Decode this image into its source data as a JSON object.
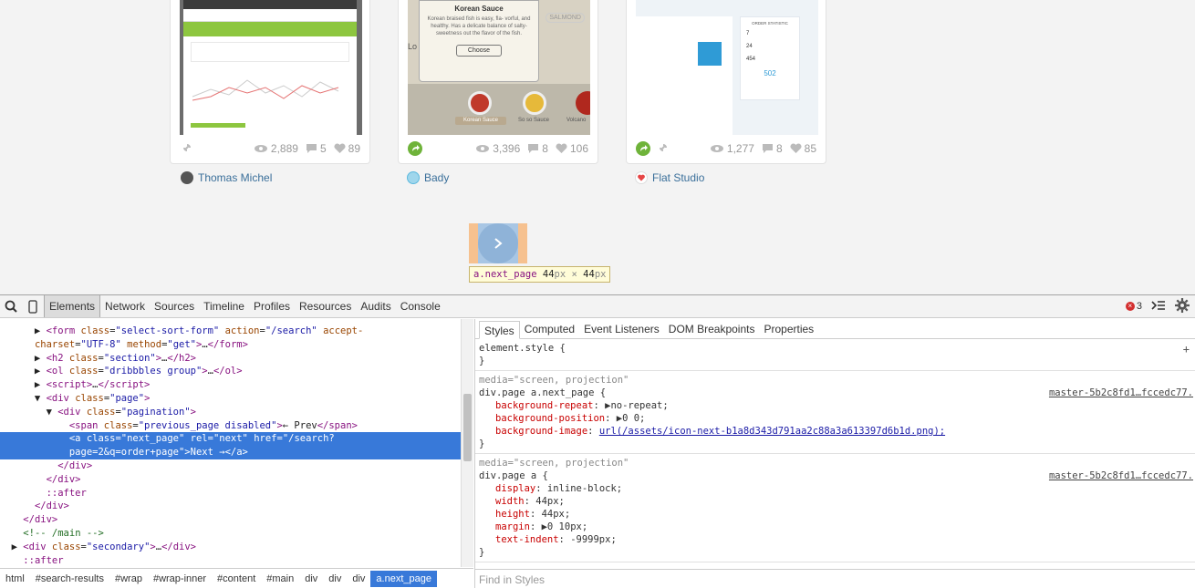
{
  "shots": [
    {
      "views": "2,889",
      "comments": "5",
      "likes": "89",
      "author": "Thomas Michel"
    },
    {
      "popup_title": "Korean Sauce",
      "popup_text": "Korean braised fish is easy, fla- vorful, and healthy. Has a delicate balance of salty-sweetness out the flavor of the fish.",
      "popup_button": "Choose",
      "corner_label": "SALMOND",
      "side_label": "Lo",
      "items": [
        "Korean Sauce",
        "So so Sauce",
        "Volcano"
      ],
      "views": "3,396",
      "comments": "8",
      "likes": "106",
      "author": "Bady"
    },
    {
      "stat_title": "ORDER STATISTIC",
      "stat_values": [
        "7",
        "24",
        "454"
      ],
      "big_value": "502",
      "views": "1,277",
      "comments": "8",
      "likes": "85",
      "author": "Flat Studio"
    }
  ],
  "tooltip": {
    "tag": "a.next_page",
    "w": "44",
    "unit": "px",
    "x": " × ",
    "h": "44"
  },
  "devtools": {
    "tabs": [
      "Elements",
      "Network",
      "Sources",
      "Timeline",
      "Profiles",
      "Resources",
      "Audits",
      "Console"
    ],
    "error_count": "3",
    "breadcrumbs": [
      "html",
      "#search-results",
      "#wrap",
      "#wrap-inner",
      "#content",
      "#main",
      "div",
      "div",
      "div",
      "a.next_page"
    ],
    "style_tabs": [
      "Styles",
      "Computed",
      "Event Listeners",
      "DOM Breakpoints",
      "Properties"
    ],
    "find_placeholder": "Find in Styles",
    "element_style": "element.style {",
    "rule1": {
      "media": "media=\"screen, projection\"",
      "selector": "div.page a.next_page {",
      "source": "master-5b2c8fd1…fccedc77.",
      "props": [
        [
          "background-repeat",
          "▶no-repeat;"
        ],
        [
          "background-position",
          "▶0 0;"
        ],
        [
          "background-image",
          "url(/assets/icon-next-b1a8d343d791aa2c88a3a613397d6b1d.png);"
        ]
      ]
    },
    "rule2": {
      "media": "media=\"screen, projection\"",
      "selector": "div.page a {",
      "source": "master-5b2c8fd1…fccedc77.",
      "props": [
        [
          "display",
          "inline-block;"
        ],
        [
          "width",
          "44px;"
        ],
        [
          "height",
          "44px;"
        ],
        [
          "margin",
          "▶0 10px;"
        ],
        [
          "text-indent",
          "-9999px;"
        ]
      ]
    }
  }
}
